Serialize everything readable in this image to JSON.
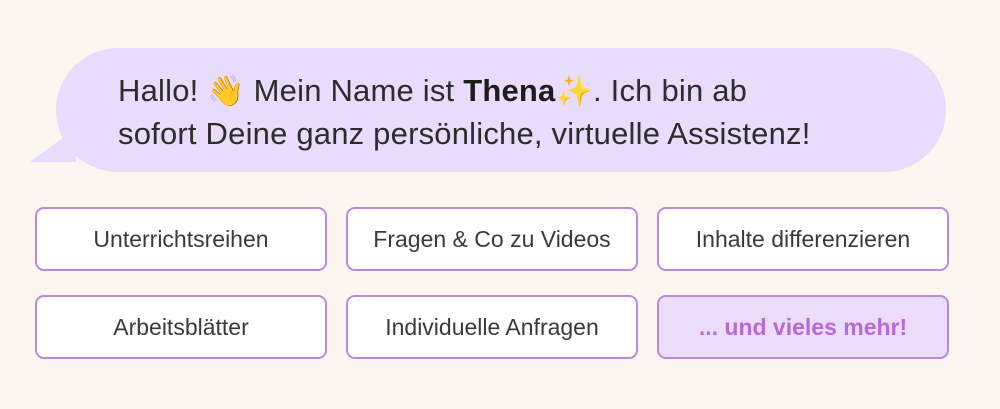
{
  "message": {
    "line1_part1": "Hallo! ",
    "wave_emoji": "👋",
    "line1_part2": " Mein Name ist ",
    "name": "Thena",
    "sparkle_emoji": "✨",
    "line1_part3": ". Ich bin ab",
    "line2": "sofort Deine ganz persönliche, virtuelle Assistenz!"
  },
  "options": [
    "Unterrichtsreihen",
    "Fragen & Co zu Videos",
    "Inhalte differenzieren",
    "Arbeitsblätter",
    "Individuelle Anfragen",
    "... und vieles mehr!"
  ],
  "colors": {
    "background": "#fdf5ef",
    "bubble": "#e8dbfb",
    "chip_border": "#b98ad8",
    "highlight_text": "#b56ad6"
  }
}
